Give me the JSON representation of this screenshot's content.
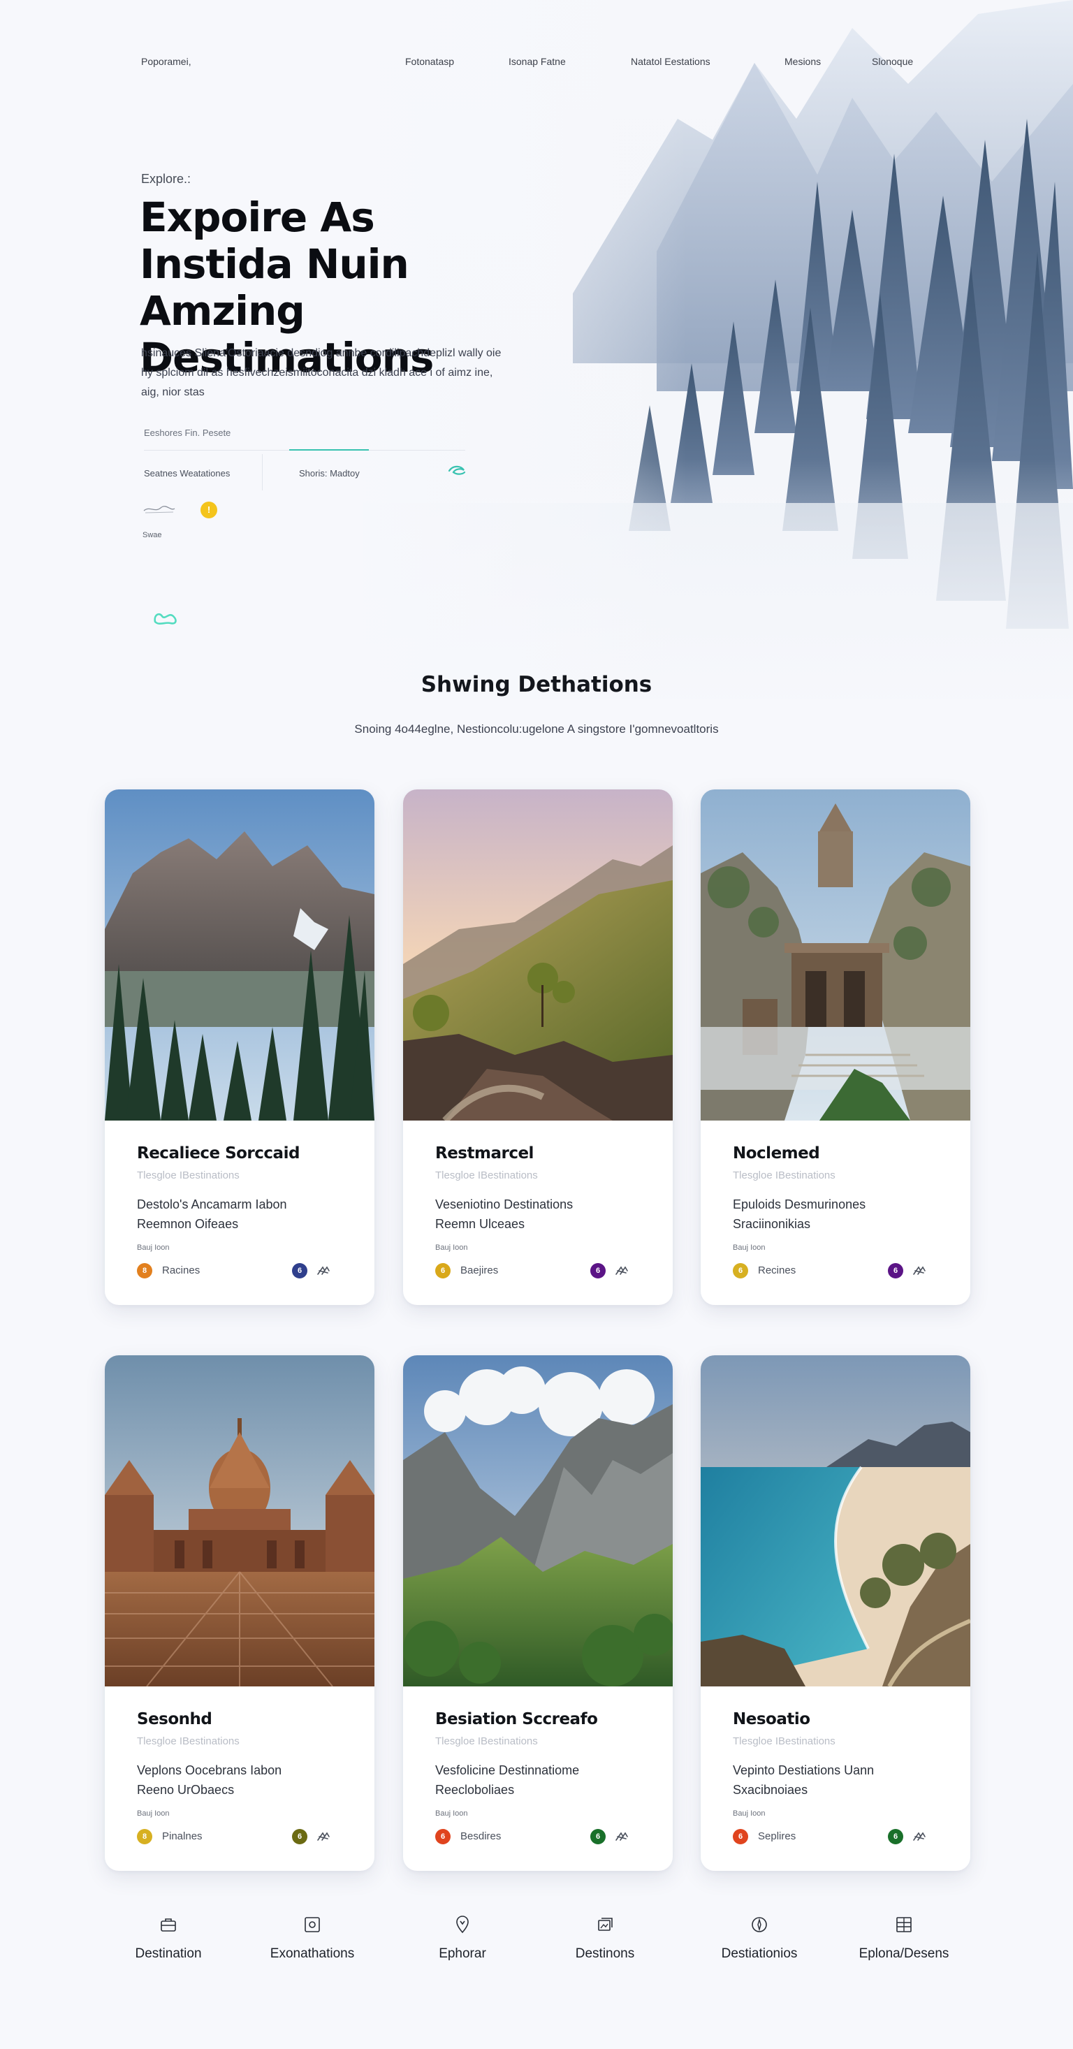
{
  "header": {
    "logo": "Poporamei,",
    "nav": [
      {
        "label": "Fotonatasp"
      },
      {
        "label": "Isonap Fatne"
      },
      {
        "label": "Natatol Eestations"
      },
      {
        "label": "Mesions"
      },
      {
        "label": "Slonoque"
      }
    ]
  },
  "hero": {
    "eyebrow": "Explore.:",
    "title_lines": [
      "Expoire As",
      "Instida Nuin",
      "Amzing Destimations"
    ],
    "description": "hsinauces Sliena'Ostoriaacie desndiog annbe cordilipachdeplizl wally oie hy splciom dil as hesfivechzeismiitoconacita dzi kladh ace i of aimz ine, aig, nior stas",
    "mini_label": "Eeshores Fin. Pesete",
    "meta_a": "Seatnes Weatationes",
    "meta_b": "Shoris: Madtoy",
    "small_note": "Swae",
    "yellow_dot": "!"
  },
  "section": {
    "title": "Shwing Dethations",
    "subtitle": "Snoing 4o44eglne, Nestioncolu:ugelone A singstore I'gomnevoatltoris"
  },
  "cards": [
    {
      "title": "Recaliece Sorccaid",
      "subtitle": "Tlesgloe IBestinations",
      "desc_1": "Destolo's Ancamarm Iabon",
      "desc_2": "Reemnon Oifeaes",
      "small": "Bauj Ioon",
      "foot_label": "Racines",
      "left_color": "#e2801e",
      "right_color": "#2f3f8c",
      "left_glyph": "8",
      "right_glyph": "6"
    },
    {
      "title": "Restmarcel",
      "subtitle": "Tlesgloe IBestinations",
      "desc_1": "Veseniotino Destinations",
      "desc_2": "Reemn Ulceaes",
      "small": "Bauj Ioon",
      "foot_label": "Baejires",
      "left_color": "#d9a81a",
      "right_color": "#5b1486",
      "left_glyph": "6",
      "right_glyph": "6"
    },
    {
      "title": "Noclemed",
      "subtitle": "Tlesgloe IBestinations",
      "desc_1": "Epuloids Desmurinones",
      "desc_2": "Sraciinonikias",
      "small": "Bauj Ioon",
      "foot_label": "Recines",
      "left_color": "#d7b021",
      "right_color": "#5b1486",
      "left_glyph": "6",
      "right_glyph": "6"
    },
    {
      "title": "Sesonhd",
      "subtitle": "Tlesgloe IBestinations",
      "desc_1": "Veplons Oocebrans Iabon",
      "desc_2": "Reeno UrObaecs",
      "small": "Bauj Ioon",
      "foot_label": "Pinalnes",
      "left_color": "#d7b021",
      "right_color": "#6b6a12",
      "left_glyph": "8",
      "right_glyph": "6"
    },
    {
      "title": "Besiation Sccreafo",
      "subtitle": "Tlesgloe IBestinations",
      "desc_1": "Vesfolicine Destinnatiome",
      "desc_2": "Reecloboliaes",
      "small": "Bauj Ioon",
      "foot_label": "Besdires",
      "left_color": "#e0441e",
      "right_color": "#19702a",
      "left_glyph": "6",
      "right_glyph": "6"
    },
    {
      "title": "Nesoatio",
      "subtitle": "Tlesgloe IBestinations",
      "desc_1": "Vepinto Destiations Uann",
      "desc_2": "Sxacibnoiaes",
      "small": "Bauj Ioon",
      "foot_label": "Seplires",
      "left_color": "#e0441e",
      "right_color": "#19702a",
      "left_glyph": "6",
      "right_glyph": "6"
    }
  ],
  "bottom_nav": [
    {
      "label": "Destination",
      "icon": "suitcase-icon"
    },
    {
      "label": "Exonathations",
      "icon": "frame-icon"
    },
    {
      "label": "Ephorar",
      "icon": "map-pin-icon"
    },
    {
      "label": "Destinons",
      "icon": "gallery-icon"
    },
    {
      "label": "Destiationios",
      "icon": "compass-icon"
    },
    {
      "label": "Eplona/Desens",
      "icon": "grid-icon"
    }
  ],
  "colors": {
    "accent": "#38c2b0",
    "text": "#1a1d24"
  }
}
